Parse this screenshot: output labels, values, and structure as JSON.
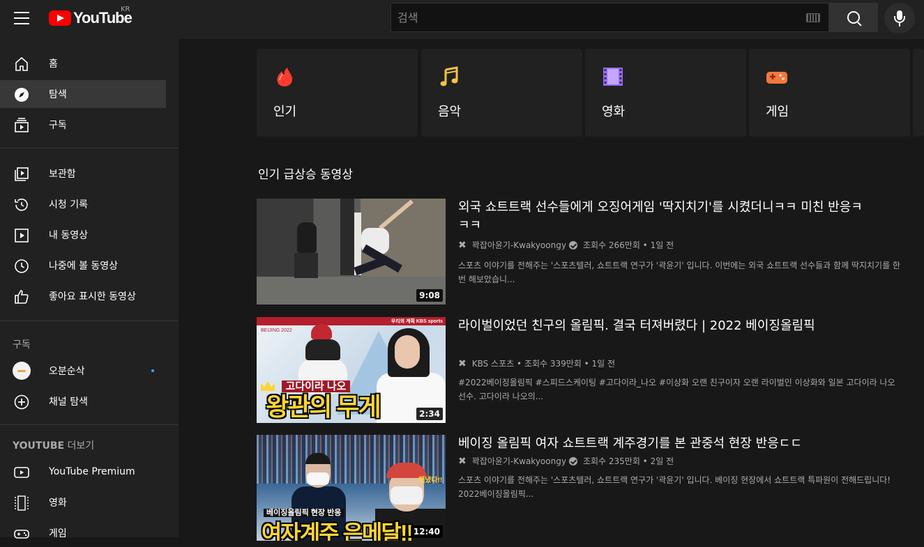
{
  "header": {
    "logo_text": "YouTube",
    "region": "KR",
    "search_placeholder": "검색"
  },
  "sidebar": {
    "main": [
      {
        "label": "홈",
        "icon": "home-icon"
      },
      {
        "label": "탐색",
        "icon": "explore-icon",
        "active": true
      },
      {
        "label": "구독",
        "icon": "subscriptions-icon"
      }
    ],
    "library": [
      {
        "label": "보관함",
        "icon": "library-icon"
      },
      {
        "label": "시청 기록",
        "icon": "history-icon"
      },
      {
        "label": "내 동영상",
        "icon": "my-videos-icon"
      },
      {
        "label": "나중에 볼 동영상",
        "icon": "watch-later-icon"
      },
      {
        "label": "좋아요 표시한 동영상",
        "icon": "liked-icon"
      }
    ],
    "subscriptions_title": "구독",
    "subscriptions": [
      {
        "label": "오분순삭",
        "icon": "channel-avatar"
      },
      {
        "label": "채널 탐색",
        "icon": "add-circle-icon"
      }
    ],
    "more_title": "YOUTUBE",
    "more_title_suffix": "더보기",
    "more": [
      {
        "label": "YouTube Premium",
        "icon": "youtube-icon"
      },
      {
        "label": "영화",
        "icon": "film-icon"
      },
      {
        "label": "게임",
        "icon": "gamepad-icon"
      }
    ]
  },
  "chips": [
    {
      "label": "인기",
      "icon": "trending-flame-icon",
      "color": "#ff3a2f"
    },
    {
      "label": "음악",
      "icon": "music-note-icon",
      "color": "#f6c343"
    },
    {
      "label": "영화",
      "icon": "film-strip-icon",
      "color": "#9b6cf2"
    },
    {
      "label": "게임",
      "icon": "gamepad-icon",
      "color": "#f2783a"
    }
  ],
  "section_title": "인기 급상승 동영상",
  "videos": [
    {
      "title": "외국 쇼트트랙 선수들에게 오징어게임 '딱지치기'를 시켰더니ㅋㅋ 미친 반응ㅋㅋㅋ",
      "channel": "꽉잡아윤기-Kwakyoongy",
      "verified": true,
      "views": "조회수 266만회",
      "age": "1일 전",
      "description": "스포츠 이야기를 전해주는 '스포츠텔러, 쇼트트랙 연구가 '곽윤기' 입니다. 이번에는 외국 쇼트트랙 선수들과 함께 딱지치기를 한 번 해보았습니...",
      "duration": "9:08"
    },
    {
      "title": "라이벌이었던 친구의 올림픽. 결국 터져버렸다 | 2022 베이징올림픽",
      "channel": "KBS 스포츠",
      "verified": false,
      "views": "조회수 339만회",
      "age": "1일 전",
      "description": "#2022베이징올림픽 #스피드스케이팅 #고다이라_나오 #이상화 오랜 친구이자 오랜 라이벌인 이상화와 일본 고다이라 나오 선수. 고다이라 나오의...",
      "duration": "2:34",
      "thumb_text": {
        "small": "고다이라 나오",
        "large": "왕관의 무게",
        "badge_left": "BEIJING 2022",
        "badge_right": "우리의 계획 KBS sports"
      }
    },
    {
      "title": "베이징 올림픽 여자 쇼트트랙 계주경기를 본 관중석 현장 반응ㄷㄷ",
      "channel": "꽉잡아윤기-Kwakyoongy",
      "verified": true,
      "views": "조회수 235만회",
      "age": "2일 전",
      "description": "스포츠 이야기를 전해주는 '스포츠텔러, 쇼트트랙 연구가 '곽윤기' 입니다. 베이징 현장에서 쇼트트랙 특파원이 전해드립니다! 2022베이징올림픽...",
      "duration": "12:40",
      "thumb_text": {
        "small": "베이징올림픽 현장 반응",
        "large": "여자계주 은메달!!",
        "cheer": "해냈다!!"
      }
    }
  ]
}
